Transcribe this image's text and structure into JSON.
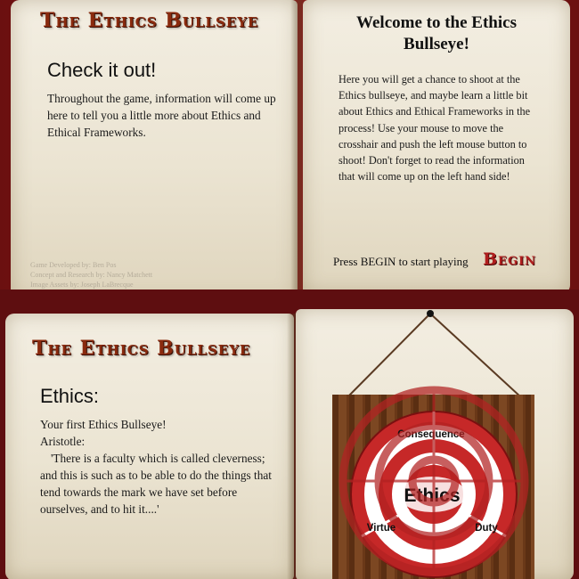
{
  "top_spread": {
    "left_page": {
      "logo": "The Ethics Bullseye",
      "heading": "Check it out!",
      "body": "Throughout the game, information will come up here to tell you a little more about Ethics and Ethical Frameworks.",
      "credits": [
        "Game Developed by: Ben Pos",
        "Concept and Research by: Nancy Matchett",
        "Image Assets by: Joseph LaBrecque"
      ]
    },
    "right_page": {
      "title": "Welcome to the Ethics Bullseye!",
      "body": "Here you will get a chance to shoot at the Ethics bullseye, and maybe learn a little bit about Ethics and Ethical Frameworks in the process! Use your mouse to move the crosshair and push the left mouse button to shoot! Don't forget to read the information that will come up on the left hand side!",
      "press_hint": "Press BEGIN to start playing",
      "begin_label": "Begin"
    }
  },
  "bottom_spread": {
    "left_page": {
      "logo": "The Ethics Bullseye",
      "heading": "Ethics:",
      "line1": "Your first Ethics Bullseye!",
      "line2": "Aristotle:",
      "quote": "'There is a faculty which is called cleverness; and this is such as to be able to do the things that tend towards the mark we have set before ourselves, and to hit it....'"
    },
    "target": {
      "center_label": "Ethics",
      "top_label": "Consequence",
      "left_label": "Virtue",
      "right_label": "Duty"
    }
  },
  "colors": {
    "frame": "#7a1416",
    "page": "#efe9db",
    "logo": "#8a2a0e",
    "begin": "#b01e1e",
    "target_red": "#c62828",
    "crosshair": "#b22222",
    "wood": "#6b3a1a"
  }
}
